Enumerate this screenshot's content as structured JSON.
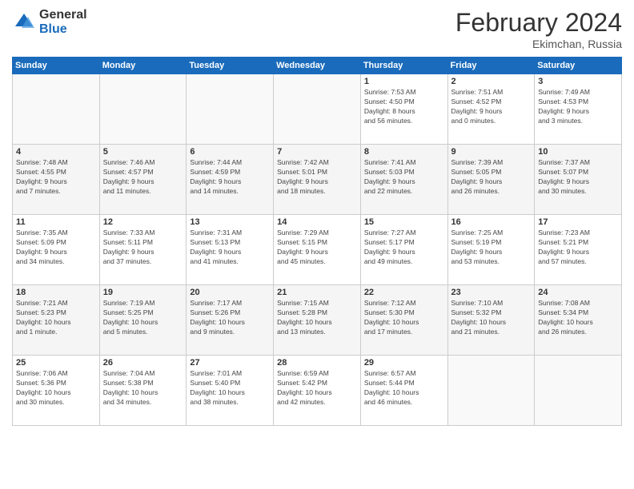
{
  "logo": {
    "general": "General",
    "blue": "Blue"
  },
  "header": {
    "month_year": "February 2024",
    "location": "Ekimchan, Russia"
  },
  "weekdays": [
    "Sunday",
    "Monday",
    "Tuesday",
    "Wednesday",
    "Thursday",
    "Friday",
    "Saturday"
  ],
  "weeks": [
    [
      {
        "day": "",
        "info": ""
      },
      {
        "day": "",
        "info": ""
      },
      {
        "day": "",
        "info": ""
      },
      {
        "day": "",
        "info": ""
      },
      {
        "day": "1",
        "info": "Sunrise: 7:53 AM\nSunset: 4:50 PM\nDaylight: 8 hours\nand 56 minutes."
      },
      {
        "day": "2",
        "info": "Sunrise: 7:51 AM\nSunset: 4:52 PM\nDaylight: 9 hours\nand 0 minutes."
      },
      {
        "day": "3",
        "info": "Sunrise: 7:49 AM\nSunset: 4:53 PM\nDaylight: 9 hours\nand 3 minutes."
      }
    ],
    [
      {
        "day": "4",
        "info": "Sunrise: 7:48 AM\nSunset: 4:55 PM\nDaylight: 9 hours\nand 7 minutes."
      },
      {
        "day": "5",
        "info": "Sunrise: 7:46 AM\nSunset: 4:57 PM\nDaylight: 9 hours\nand 11 minutes."
      },
      {
        "day": "6",
        "info": "Sunrise: 7:44 AM\nSunset: 4:59 PM\nDaylight: 9 hours\nand 14 minutes."
      },
      {
        "day": "7",
        "info": "Sunrise: 7:42 AM\nSunset: 5:01 PM\nDaylight: 9 hours\nand 18 minutes."
      },
      {
        "day": "8",
        "info": "Sunrise: 7:41 AM\nSunset: 5:03 PM\nDaylight: 9 hours\nand 22 minutes."
      },
      {
        "day": "9",
        "info": "Sunrise: 7:39 AM\nSunset: 5:05 PM\nDaylight: 9 hours\nand 26 minutes."
      },
      {
        "day": "10",
        "info": "Sunrise: 7:37 AM\nSunset: 5:07 PM\nDaylight: 9 hours\nand 30 minutes."
      }
    ],
    [
      {
        "day": "11",
        "info": "Sunrise: 7:35 AM\nSunset: 5:09 PM\nDaylight: 9 hours\nand 34 minutes."
      },
      {
        "day": "12",
        "info": "Sunrise: 7:33 AM\nSunset: 5:11 PM\nDaylight: 9 hours\nand 37 minutes."
      },
      {
        "day": "13",
        "info": "Sunrise: 7:31 AM\nSunset: 5:13 PM\nDaylight: 9 hours\nand 41 minutes."
      },
      {
        "day": "14",
        "info": "Sunrise: 7:29 AM\nSunset: 5:15 PM\nDaylight: 9 hours\nand 45 minutes."
      },
      {
        "day": "15",
        "info": "Sunrise: 7:27 AM\nSunset: 5:17 PM\nDaylight: 9 hours\nand 49 minutes."
      },
      {
        "day": "16",
        "info": "Sunrise: 7:25 AM\nSunset: 5:19 PM\nDaylight: 9 hours\nand 53 minutes."
      },
      {
        "day": "17",
        "info": "Sunrise: 7:23 AM\nSunset: 5:21 PM\nDaylight: 9 hours\nand 57 minutes."
      }
    ],
    [
      {
        "day": "18",
        "info": "Sunrise: 7:21 AM\nSunset: 5:23 PM\nDaylight: 10 hours\nand 1 minute."
      },
      {
        "day": "19",
        "info": "Sunrise: 7:19 AM\nSunset: 5:25 PM\nDaylight: 10 hours\nand 5 minutes."
      },
      {
        "day": "20",
        "info": "Sunrise: 7:17 AM\nSunset: 5:26 PM\nDaylight: 10 hours\nand 9 minutes."
      },
      {
        "day": "21",
        "info": "Sunrise: 7:15 AM\nSunset: 5:28 PM\nDaylight: 10 hours\nand 13 minutes."
      },
      {
        "day": "22",
        "info": "Sunrise: 7:12 AM\nSunset: 5:30 PM\nDaylight: 10 hours\nand 17 minutes."
      },
      {
        "day": "23",
        "info": "Sunrise: 7:10 AM\nSunset: 5:32 PM\nDaylight: 10 hours\nand 21 minutes."
      },
      {
        "day": "24",
        "info": "Sunrise: 7:08 AM\nSunset: 5:34 PM\nDaylight: 10 hours\nand 26 minutes."
      }
    ],
    [
      {
        "day": "25",
        "info": "Sunrise: 7:06 AM\nSunset: 5:36 PM\nDaylight: 10 hours\nand 30 minutes."
      },
      {
        "day": "26",
        "info": "Sunrise: 7:04 AM\nSunset: 5:38 PM\nDaylight: 10 hours\nand 34 minutes."
      },
      {
        "day": "27",
        "info": "Sunrise: 7:01 AM\nSunset: 5:40 PM\nDaylight: 10 hours\nand 38 minutes."
      },
      {
        "day": "28",
        "info": "Sunrise: 6:59 AM\nSunset: 5:42 PM\nDaylight: 10 hours\nand 42 minutes."
      },
      {
        "day": "29",
        "info": "Sunrise: 6:57 AM\nSunset: 5:44 PM\nDaylight: 10 hours\nand 46 minutes."
      },
      {
        "day": "",
        "info": ""
      },
      {
        "day": "",
        "info": ""
      }
    ]
  ]
}
